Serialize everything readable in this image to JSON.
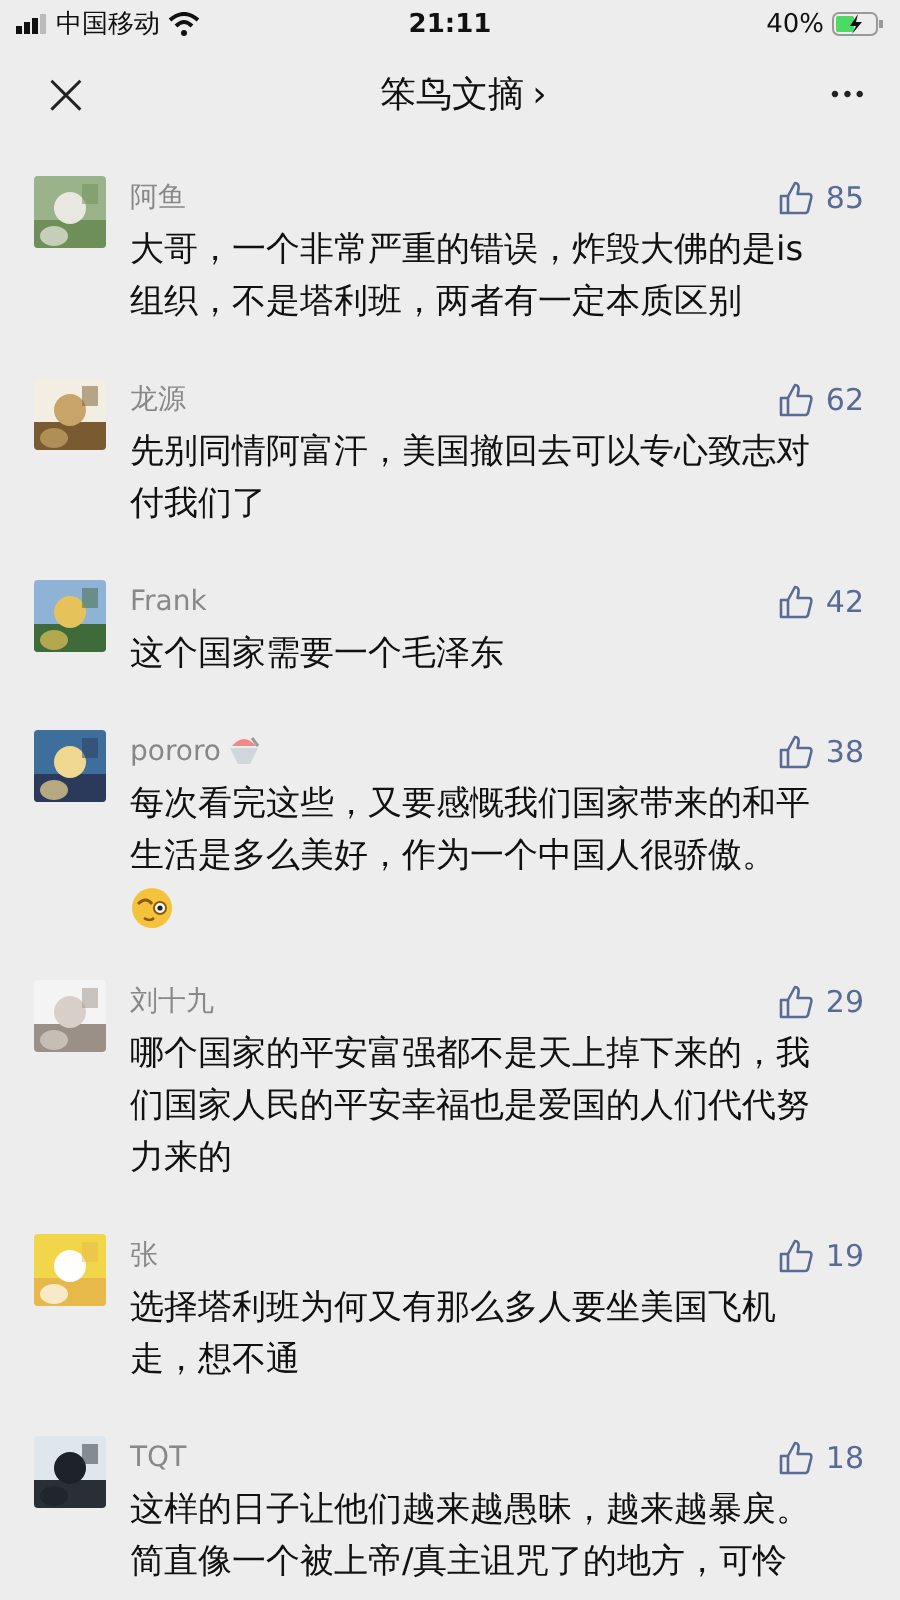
{
  "status_bar": {
    "carrier": "中国移动",
    "time": "21:11",
    "battery": "40%"
  },
  "header": {
    "close": "×",
    "title": "笨鸟文摘",
    "chevron": "›",
    "more": "•••"
  },
  "comments": [
    {
      "name": "阿鱼",
      "likes": "85",
      "text": "大哥，一个非常严重的错误，炸毁大佛的是is组织，不是塔利班，两者有一定本质区别"
    },
    {
      "name": "龙源",
      "likes": "62",
      "text": "先别同情阿富汗，美国撤回去可以专心致志对付我们了"
    },
    {
      "name": "Frank",
      "likes": "42",
      "text": "这个国家需要一个毛泽东"
    },
    {
      "name": "pororo",
      "likes": "38",
      "name_emoji": true,
      "text": "每次看完这些，又要感慨我们国家带来的和平生活是多么美好，作为一个中国人很骄傲。",
      "text_emoji": true
    },
    {
      "name": "刘十九",
      "likes": "29",
      "text": "哪个国家的平安富强都不是天上掉下来的，我们国家人民的平安幸福也是爱国的人们代代努力来的"
    },
    {
      "name": "张",
      "likes": "19",
      "text": "选择塔利班为何又有那么多人要坐美国飞机走，想不通"
    },
    {
      "name": "TQT",
      "likes": "18",
      "text": "这样的日子让他们越来越愚昧，越来越暴戾。简直像一个被上帝/真主诅咒了的地方，可怜"
    }
  ]
}
